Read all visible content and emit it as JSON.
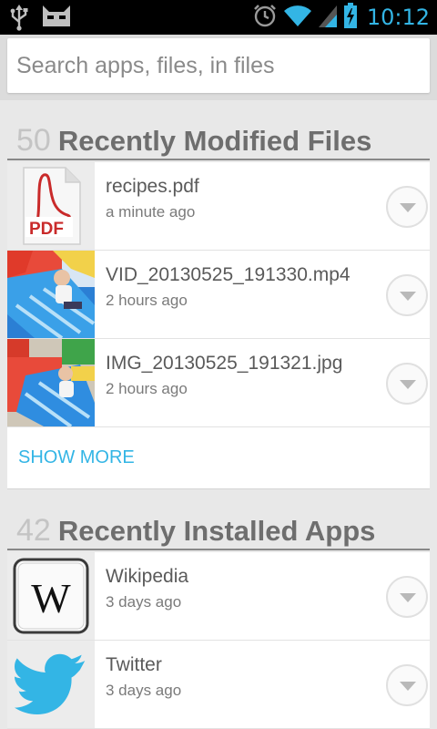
{
  "status_bar": {
    "time": "10:12",
    "accent": "#33b5e5"
  },
  "search": {
    "placeholder": "Search apps, files, in files",
    "value": ""
  },
  "recent_files": {
    "count": "50",
    "title": "Recently Modified Files",
    "items": [
      {
        "name": "recipes.pdf",
        "time": "a minute ago",
        "icon": "pdf-icon"
      },
      {
        "name": "VID_20130525_191330.mp4",
        "time": "2 hours ago",
        "icon": "video-thumbnail"
      },
      {
        "name": "IMG_20130525_191321.jpg",
        "time": "2 hours ago",
        "icon": "image-thumbnail"
      }
    ],
    "show_more": "SHOW MORE"
  },
  "recent_apps": {
    "count": "42",
    "title": "Recently Installed Apps",
    "items": [
      {
        "name": "Wikipedia",
        "time": "3 days ago",
        "icon": "wikipedia-icon"
      },
      {
        "name": "Twitter",
        "time": "3 days ago",
        "icon": "twitter-icon"
      }
    ]
  }
}
